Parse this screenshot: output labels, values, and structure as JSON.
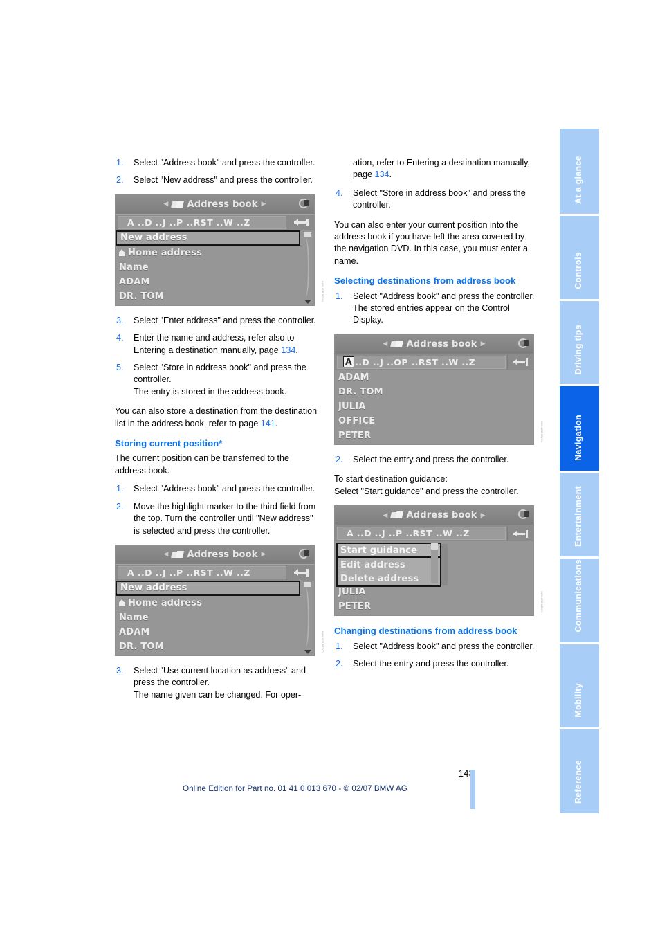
{
  "document": {
    "page_number": "143",
    "footer_note": "Online Edition for Part no. 01 41 0 013 670 - © 02/07 BMW AG"
  },
  "tab_rail": {
    "items": [
      {
        "label": "At a glance",
        "active": false
      },
      {
        "label": "Controls",
        "active": false
      },
      {
        "label": "Driving tips",
        "active": false
      },
      {
        "label": "Navigation",
        "active": true
      },
      {
        "label": "Entertainment",
        "active": false
      },
      {
        "label": "Communications",
        "active": false
      },
      {
        "label": "Mobility",
        "active": false
      },
      {
        "label": "Reference",
        "active": false
      }
    ],
    "colors": {
      "inactive": "#a8cdf7",
      "active": "#0b64e8",
      "label": "#ffffff"
    }
  },
  "left_column": {
    "steps_top": [
      {
        "num": "1.",
        "text": "Select \"Address book\" and press the controller."
      },
      {
        "num": "2.",
        "text": "Select \"New address\" and press the controller."
      }
    ],
    "shot1": {
      "title": "Address book",
      "letters_prefix": "",
      "letters": "A ..D ..J ..P ..RST ..W ..Z",
      "rows": [
        {
          "text": "New address",
          "selected": true,
          "home": false
        },
        {
          "text": "Home address",
          "selected": false,
          "home": true
        },
        {
          "text": "Name",
          "selected": false,
          "home": false
        },
        {
          "text": "ADAM",
          "selected": false,
          "home": false
        },
        {
          "text": "DR. TOM",
          "selected": false,
          "home": false
        }
      ],
      "credit": "NAVI-ADR-NEU01"
    },
    "steps_mid": [
      {
        "num": "3.",
        "text": "Select \"Enter address\" and press the controller."
      },
      {
        "num": "4.",
        "text": "Enter the name and address, refer also to Entering a destination manually, page ",
        "link": "134",
        "tail": "."
      },
      {
        "num": "5.",
        "text": "Select \"Store in address book\" and press the controller.\nThe entry is stored in the address book."
      }
    ],
    "para_store": "You can also store a destination from the destination list in the address book, refer to page ",
    "para_store_link": "141",
    "para_store_tail": ".",
    "heading_storing": "Storing current position*",
    "para_current": "The current position can be transferred to the address book.",
    "steps_storing": [
      {
        "num": "1.",
        "text": "Select \"Address book\" and press the controller."
      },
      {
        "num": "2.",
        "text": "Move the highlight marker to the third field from the top. Turn the controller until \"New address\" is selected and press the controller."
      }
    ],
    "shot2": {
      "title": "Address book",
      "letters": "A ..D ..J ..P ..RST ..W ..Z",
      "rows": [
        {
          "text": "New address",
          "selected": true,
          "home": false
        },
        {
          "text": "Home address",
          "selected": false,
          "home": true
        },
        {
          "text": "Name",
          "selected": false,
          "home": false
        },
        {
          "text": "ADAM",
          "selected": false,
          "home": false
        },
        {
          "text": "DR. TOM",
          "selected": false,
          "home": false
        }
      ],
      "credit": "NAVI-ADR-NEU02"
    },
    "steps_bottom": [
      {
        "num": "3.",
        "text": "Select \"Use current location as address\" and press the controller.\nThe name given can be changed. For oper-"
      }
    ]
  },
  "right_column": {
    "para_continue": "ation, refer to Entering a destination manually, page ",
    "para_continue_link": "134",
    "para_continue_tail": ".",
    "steps_top": [
      {
        "num": "4.",
        "text": "Select \"Store in address book\" and press the controller."
      }
    ],
    "para_dvd": "You can also enter your current position into the address book if you have left the area covered by the navigation DVD. In this case, you must enter a name.",
    "heading_selecting": "Selecting destinations from address book",
    "steps_selecting": [
      {
        "num": "1.",
        "text": "Select \"Address book\" and press the controller.\nThe stored entries appear on the Control Display."
      }
    ],
    "shot3": {
      "title": "Address book",
      "letters_selected": "A",
      "letters": "..D ..J ..OP ..RST ..W ..Z",
      "rows": [
        {
          "text": "ADAM"
        },
        {
          "text": "DR. TOM"
        },
        {
          "text": "JULIA"
        },
        {
          "text": "OFFICE"
        },
        {
          "text": "PETER"
        }
      ],
      "credit": "NAVI-ADR-SEL01"
    },
    "steps_after_shot3": [
      {
        "num": "2.",
        "text": "Select the entry and press the controller."
      }
    ],
    "para_guidance": "To start destination guidance:\nSelect \"Start guidance\" and press the controller.",
    "shot4": {
      "title": "Address book",
      "letters": "A ..D ..J ..P ..RST ..W ..Z",
      "popup": [
        {
          "text": "Start guidance",
          "selected": true
        },
        {
          "text": "Edit address",
          "selected": false
        },
        {
          "text": "Delete address",
          "selected": false
        }
      ],
      "rows": [
        {
          "text": "JULIA"
        },
        {
          "text": "PETER"
        }
      ],
      "credit": "NAVI-ADR-MEN01"
    },
    "heading_changing": "Changing destinations from address book",
    "steps_changing": [
      {
        "num": "1.",
        "text": "Select \"Address book\" and press the controller."
      },
      {
        "num": "2.",
        "text": "Select the entry and press the controller."
      }
    ]
  }
}
